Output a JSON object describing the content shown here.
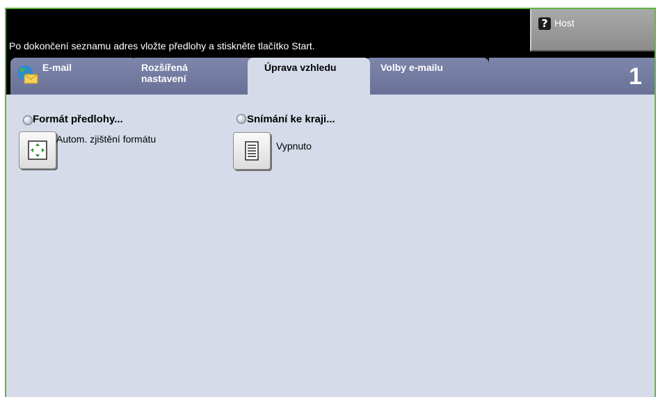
{
  "header": {
    "message": "Po dokončení seznamu adres vložte předlohy a stiskněte tlačítko Start.",
    "host_label": "Host",
    "host_icon": "question-mark-icon"
  },
  "tabs": [
    {
      "label": "E-mail",
      "icon": "email-globe-icon",
      "active": false
    },
    {
      "label_line1": "Rozšířená",
      "label_line2": "nastavení",
      "active": false
    },
    {
      "label": "Úprava vzhledu",
      "active": true
    },
    {
      "label": "Volby e-mailu",
      "active": false
    }
  ],
  "page_number": "1",
  "options": [
    {
      "title": "Formát předlohy...",
      "value": "Autom. zjištění formátu",
      "icon": "auto-size-detect-icon"
    },
    {
      "title": "Snímání ke kraji...",
      "value": "Vypnuto",
      "icon": "document-page-icon"
    }
  ],
  "colors": {
    "frame_border": "#5cb83a",
    "header_bg": "#000000",
    "tab_bg": "#7e86ac",
    "content_bg": "#d5dbe9"
  }
}
